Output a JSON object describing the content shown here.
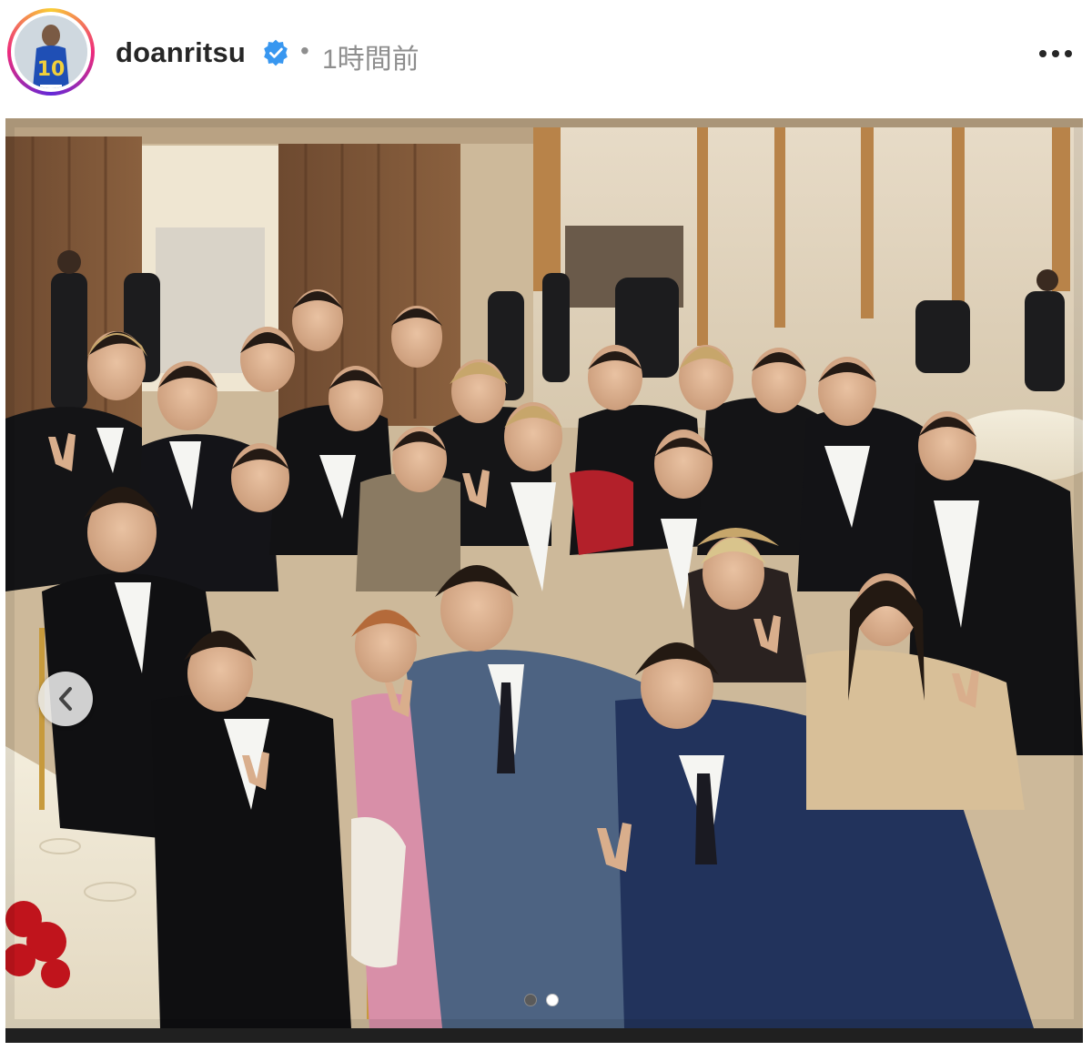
{
  "post_header": {
    "username": "doanritsu",
    "separator": "•",
    "timestamp": "1時間前",
    "verified_icon": "verified-badge-icon",
    "more_icon": "more-options-icon"
  },
  "photo": {
    "description_icon": "group-photo-image",
    "carousel": {
      "prev_icon": "chevron-left-icon",
      "total_dots": 2,
      "active_dot": 1
    }
  },
  "colors": {
    "verified_blue": "#3897f0",
    "timestamp_gray": "#8e8e8e",
    "text_dark": "#262626"
  }
}
